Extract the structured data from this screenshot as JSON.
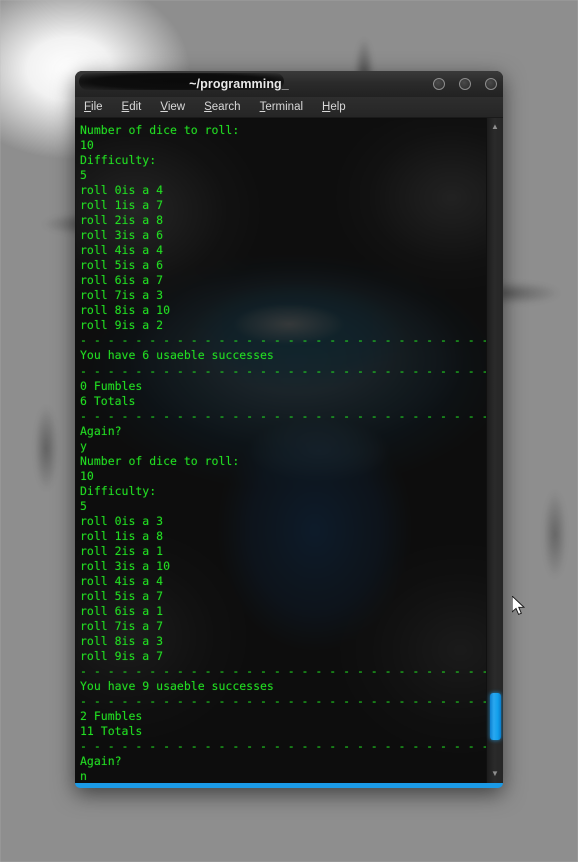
{
  "desktop": {
    "wallpaper_name": "hexagon-3d-wallpaper",
    "cursor_name": "mouse-pointer"
  },
  "window": {
    "title": "~/programming_",
    "controls": [
      {
        "name": "minimize-button",
        "glyph": ""
      },
      {
        "name": "maximize-button",
        "glyph": ""
      },
      {
        "name": "close-button",
        "glyph": ""
      }
    ],
    "accent_color": "#1b9ae6"
  },
  "menubar": {
    "items": [
      {
        "name": "menu-file",
        "accel": "F",
        "rest": "ile"
      },
      {
        "name": "menu-edit",
        "accel": "E",
        "rest": "dit"
      },
      {
        "name": "menu-view",
        "accel": "V",
        "rest": "iew"
      },
      {
        "name": "menu-search",
        "accel": "S",
        "rest": "earch"
      },
      {
        "name": "menu-terminal",
        "accel": "T",
        "rest": "erminal"
      },
      {
        "name": "menu-help",
        "accel": "H",
        "rest": "elp"
      }
    ]
  },
  "terminal": {
    "text_color": "#22dd22",
    "separator": "- - - - - - - - - - - - - - - - - - - - - - - - - - - - - - - - - - - - - - -",
    "content": "Number of dice to roll:\n10\nDifficulty:\n5\nroll 0is a 4\nroll 1is a 7\nroll 2is a 8\nroll 3is a 6\nroll 4is a 4\nroll 5is a 6\nroll 6is a 7\nroll 7is a 3\nroll 8is a 10\nroll 9is a 2\n- - - - - - - - - - - - - - - - - - - - - - - - - - - - - - - - - - - - - - -\nYou have 6 usaeble successes\n- - - - - - - - - - - - - - - - - - - - - - - - - - - - - - - - - - - - - - -\n0 Fumbles\n6 Totals\n- - - - - - - - - - - - - - - - - - - - - - - - - - - - - - - - - - - - - - -\nAgain?\ny\nNumber of dice to roll:\n10\nDifficulty:\n5\nroll 0is a 3\nroll 1is a 8\nroll 2is a 1\nroll 3is a 10\nroll 4is a 4\nroll 5is a 7\nroll 6is a 1\nroll 7is a 7\nroll 8is a 3\nroll 9is a 7\n- - - - - - - - - - - - - - - - - - - - - - - - - - - - - - - - - - - - - - -\nYou have 9 usaeble successes\n- - - - - - - - - - - - - - - - - - - - - - - - - - - - - - - - - - - - - - -\n2 Fumbles\n11 Totals\n- - - - - - - - - - - - - - - - - - - - - - - - - - - - - - - - - - - - - - -\nAgain?\nn",
    "sessions": [
      {
        "prompt_dice": "Number of dice to roll:",
        "dice_count": "10",
        "prompt_difficulty": "Difficulty:",
        "difficulty": "5",
        "rolls": [
          {
            "label": "roll 0is a",
            "value": "4"
          },
          {
            "label": "roll 1is a",
            "value": "7"
          },
          {
            "label": "roll 2is a",
            "value": "8"
          },
          {
            "label": "roll 3is a",
            "value": "6"
          },
          {
            "label": "roll 4is a",
            "value": "4"
          },
          {
            "label": "roll 5is a",
            "value": "6"
          },
          {
            "label": "roll 6is a",
            "value": "7"
          },
          {
            "label": "roll 7is a",
            "value": "3"
          },
          {
            "label": "roll 8is a",
            "value": "10"
          },
          {
            "label": "roll 9is a",
            "value": "2"
          }
        ],
        "successes_line": "You have 6 usaeble successes",
        "fumbles_line": "0 Fumbles",
        "totals_line": "6 Totals",
        "again_prompt": "Again?",
        "again_answer": "y"
      },
      {
        "prompt_dice": "Number of dice to roll:",
        "dice_count": "10",
        "prompt_difficulty": "Difficulty:",
        "difficulty": "5",
        "rolls": [
          {
            "label": "roll 0is a",
            "value": "3"
          },
          {
            "label": "roll 1is a",
            "value": "8"
          },
          {
            "label": "roll 2is a",
            "value": "1"
          },
          {
            "label": "roll 3is a",
            "value": "10"
          },
          {
            "label": "roll 4is a",
            "value": "4"
          },
          {
            "label": "roll 5is a",
            "value": "7"
          },
          {
            "label": "roll 6is a",
            "value": "1"
          },
          {
            "label": "roll 7is a",
            "value": "7"
          },
          {
            "label": "roll 8is a",
            "value": "3"
          },
          {
            "label": "roll 9is a",
            "value": "7"
          }
        ],
        "successes_line": "You have 9 usaeble successes",
        "fumbles_line": "2 Fumbles",
        "totals_line": "11 Totals",
        "again_prompt": "Again?",
        "again_answer": "n"
      }
    ]
  },
  "scrollbar": {
    "up_arrow": "▲",
    "down_arrow": "▼",
    "thumb_color": "#12a0ec"
  }
}
